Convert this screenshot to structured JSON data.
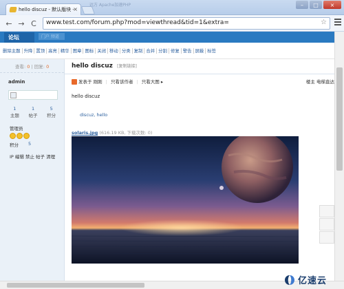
{
  "browser": {
    "background_title": "远方 Apache加速PHP",
    "tab_title": "hello discuz - 默认版块 -",
    "url": "www.test.com/forum.php?mod=viewthread&tid=1&extra=",
    "close_glyph": "×",
    "back_glyph": "←",
    "forward_glyph": "→",
    "reload_glyph": "C",
    "star_glyph": "☆"
  },
  "forum": {
    "brand": "论坛",
    "faded_nav": "门户 频道",
    "admin_tools": [
      "删除主题",
      "升降",
      "置顶",
      "高亮",
      "精华",
      "图章",
      "图标",
      "关闭",
      "移动",
      "分类",
      "复制",
      "合并",
      "分割",
      "修复",
      "警告",
      "屏蔽",
      "标签"
    ]
  },
  "sidebar": {
    "views_label": "查看:",
    "views_value": "0",
    "replies_label": "回复:",
    "replies_value": "0",
    "sep": "|",
    "username": "admin",
    "counts": [
      {
        "value": "1",
        "label": "主题"
      },
      {
        "value": "1",
        "label": "帖子"
      },
      {
        "value": "5",
        "label": "积分"
      }
    ],
    "group": "管理员",
    "points_label": "积分",
    "points_value": "5",
    "ip_row": "IP 编辑 禁止 帖子 清理"
  },
  "post": {
    "title": "hello discuz",
    "copy_link": "[复制链接]",
    "posted_at": "发表于 刚刚",
    "only_author": "只看该作者",
    "large_image": "只看大图 ▸",
    "right_meta": "楼主   电梯直达",
    "body": "hello discuz",
    "tags": "discuz, hello",
    "attachment_name": "solaris.jpg",
    "attachment_info": "(616.19 KB, 下载次数: 0)"
  },
  "watermark": {
    "text": "亿速云"
  },
  "colors": {
    "accent": "#2a7ac1",
    "link": "#2b5f9e",
    "sidebar_bg": "#eaf1f8"
  }
}
